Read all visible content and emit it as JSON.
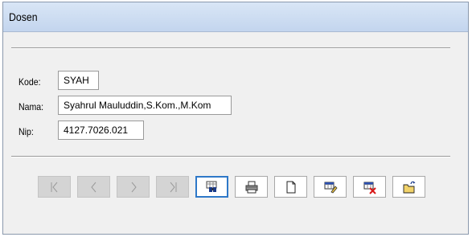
{
  "window": {
    "title": "Dosen"
  },
  "form": {
    "kode": {
      "label": "Kode:",
      "value": "SYAH"
    },
    "nama": {
      "label": "Nama:",
      "value": "Syahrul Mauluddin,S.Kom.,M.Kom"
    },
    "nip": {
      "label": "Nip:",
      "value": "4127.7026.021"
    }
  },
  "toolbar": {
    "buttons": [
      {
        "name": "first-record",
        "icon": "first-record-icon",
        "enabled": false
      },
      {
        "name": "previous-record",
        "icon": "previous-record-icon",
        "enabled": false
      },
      {
        "name": "next-record",
        "icon": "next-record-icon",
        "enabled": false
      },
      {
        "name": "last-record",
        "icon": "last-record-icon",
        "enabled": false
      },
      {
        "name": "search",
        "icon": "binoculars-icon",
        "enabled": true,
        "focused": true
      },
      {
        "name": "print",
        "icon": "printer-icon",
        "enabled": true
      },
      {
        "name": "new",
        "icon": "new-document-icon",
        "enabled": true
      },
      {
        "name": "edit",
        "icon": "edit-icon",
        "enabled": true
      },
      {
        "name": "delete",
        "icon": "delete-icon",
        "enabled": true
      },
      {
        "name": "open",
        "icon": "open-folder-icon",
        "enabled": true
      }
    ]
  },
  "colors": {
    "titlebar": "#c8d8ee",
    "focus": "#2e78c8",
    "disabled": "#d4d4d4"
  }
}
